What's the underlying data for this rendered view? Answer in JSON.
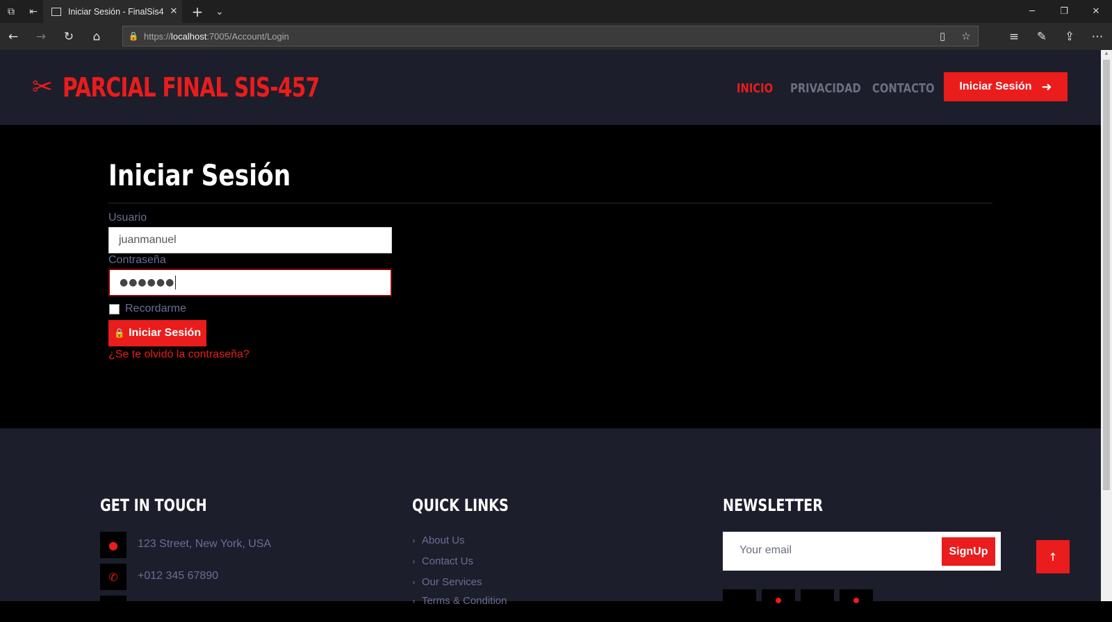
{
  "browser": {
    "tab_title": "Iniciar Sesión - FinalSis4",
    "url_prefix": "https://",
    "url_host": "localhost",
    "url_path": ":7005/Account/Login"
  },
  "header": {
    "brand": "PARCIAL FINAL SIS-457",
    "brand_icon": "scissors-icon",
    "nav": [
      {
        "label": "INICIO",
        "active": true
      },
      {
        "label": "PRIVACIDAD",
        "active": false
      },
      {
        "label": "CONTACTO",
        "active": false
      }
    ],
    "login_button": "Iniciar Sesión"
  },
  "login": {
    "title": "Iniciar Sesión",
    "username_label": "Usuario",
    "username_value": "juanmanuel",
    "password_label": "Contraseña",
    "password_mask": "●●●●●●",
    "remember_label": "Recordarme",
    "remember_checked": false,
    "submit_label": "Iniciar Sesión",
    "forgot_link": "¿Se te olvidó la contraseña?"
  },
  "footer": {
    "contact": {
      "title": "GET IN TOUCH",
      "address": "123 Street, New York, USA",
      "phone": "+012 345 67890"
    },
    "quick_links": {
      "title": "QUICK LINKS",
      "items": [
        "About Us",
        "Contact Us",
        "Our Services",
        "Terms & Condition"
      ]
    },
    "newsletter": {
      "title": "NEWSLETTER",
      "placeholder": "Your email",
      "button": "SignUp"
    }
  },
  "colors": {
    "accent": "#ea1c1c",
    "header_bg": "#1c1e2b",
    "main_bg": "#000000",
    "muted_text": "#6b6f94"
  }
}
